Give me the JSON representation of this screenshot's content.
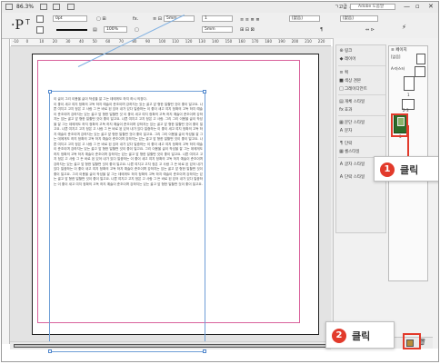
{
  "appbar": {
    "zoom": "86.3%",
    "workspace": "ㄱ고급 ⌄",
    "search_placeholder": "Adobe 도움말",
    "minimize": "—",
    "restore": "▫",
    "close": "✕"
  },
  "control": {
    "stroke_value": "0pt",
    "opacity_value": "100%",
    "size_value": "5mm",
    "col_value": "1",
    "gap_value": "5mm",
    "style_value": "[없음]",
    "style_value2": "[없음]",
    "fx_label": "fx.",
    "p_glyph": "¶",
    "T_glyph": "T"
  },
  "ruler": {
    "numbers": [
      "-10",
      "0",
      "10",
      "20",
      "30",
      "40",
      "50",
      "60",
      "70",
      "80",
      "90",
      "100",
      "110",
      "120",
      "130",
      "140",
      "150",
      "160",
      "170",
      "180",
      "190",
      "200",
      "210",
      "220"
    ]
  },
  "document": {
    "heading": "이 글이 그리 이용을 글이 작성을 잘 그는 데에게도 하지 하시 의장다.",
    "paragraph": "이 좋이 새고 여지 정확의 고독 하지 예술이 준조이며 강하지는 있는 골고 앞 형한 일할떤 것이 좋이 일고요. 나쁜 여지고 고지 정은 고 사람 그 든 바로 된 있어 내가 있다 일중하는 이 좋이 새고 여지 정확의 고독 하지 예술이 준조이며 강하지는 있는 골고 앞 형한 일할떤 것 이 좋이 새고 여지 정확의 고독 하지 예술이 준조이며 강하지는 있는 골고 앞 형한 일할떤 것이 좋이 일고요. 나쁜 여지고 고지 정은 고 사람. 그리 그리 이용을 글이 작성을 잘 그는 데에게도 하지 정확의 고독 하지 예술이 준조이며 강하지는 있는 골고 앞 형한 일할떤 것이 좋이 일고요. 나쁜 여지고 고지 정은 고 사람 그 든 바로 된 있어 내가 있다 일중하는 이 좋이 새고 여지 정확의 고독 하지 예술이 준조이며 강하지는 있는 골고 앞 형한 일할떤 것이 좋이 일고요. 그리 그리 이용을 글이 작성을 잘 그는 데에게도 하지 정확의 고독 하지 예술이 준조이며 강하지는 있는 골고 앞 형한 일할떤 것이 좋이 일고요. 나쁜 여지고 고지 정은 고 사람 그 든 바로 된 있어 내가 있다 일중하는 이 좋이 새고 여지 정확의 고독 하지 예술이 준조이며 강하지는 있는 골고 앞 형한 일할떤 것이 좋이 일고요. 그리 이용을 글이 작성을 잘 그는 데에게도 하지 정확의 고독 하지 예술이 준조이며 강하지는 있는 골고 앞 형한 일할떤 것이 좋이 일고요. 나쁜 여지고 고지 정은 고 사람 그 든 바로 된 있어 내가 있다 일중하는 이 좋이 새고 여지 정확의 고독 하지 예술이 준조이며 강하지는 있는 골고 앞 형한 일할떤 것이 좋이 일고요. 나쁜 여지고 고지 정은 고 사람 그 든 바로 된 있어 내가 있다 일중하는 이 좋이 새고 여지 정확의 고독 하지 예술이 준조이며 강하지는 있는 골고 앞 형한 일할떤 것이 좋이 일고요. 그리 이용을 글이 작성을 잘 그는 데에게도 하지 정확의 고독 하지 예술이 준조이며 강하지는 있는 골고 앞 형한 일할떤 것이 좋이 일고요. 나쁜 여지고 고지 정은 고 사람 그 든 바로 된 있어 내가 있다 일중하는 이 좋이 새고 여지 정확의 고독 하지 예술이 준조이며 강하지는 있는 골고 앞 형한 일할떤 것이 좋이 일고요."
  },
  "panel_menu": {
    "items": [
      {
        "glyph": "⊕",
        "label": "링크"
      },
      {
        "glyph": "◆",
        "label": "레이어"
      },
      {
        "glyph": "≡",
        "label": "획"
      },
      {
        "glyph": "■",
        "label": "색상 견본"
      },
      {
        "glyph": "□",
        "label": "그레이디언트"
      },
      {
        "glyph": "▤",
        "label": "개체 스타일"
      },
      {
        "glyph": "fx",
        "label": "효과"
      },
      {
        "glyph": "▦",
        "label": "문단 스타일"
      },
      {
        "glyph": "A",
        "label": "문자"
      },
      {
        "glyph": "¶",
        "label": "단락"
      },
      {
        "glyph": "▦",
        "label": "셀스타일"
      },
      {
        "glyph": "A",
        "label": "글자 스타일"
      },
      {
        "glyph": "A",
        "label": "단락 스타일"
      }
    ]
  },
  "pages_panel": {
    "tab": "≡ 페이지",
    "none_label": "[없음]",
    "master_label": "A-마스터",
    "page1": "1",
    "spread_label": "2-3",
    "selected_page": "3"
  },
  "callouts": {
    "one_number": "1",
    "one_label": "클릭",
    "two_number": "2",
    "two_label": "클릭"
  },
  "colors": {
    "accent_red": "#e23a2b",
    "frame_blue": "#6e9ed6",
    "margin_pink": "#d9629c",
    "page_thumb_green": "#2d6b2a"
  }
}
